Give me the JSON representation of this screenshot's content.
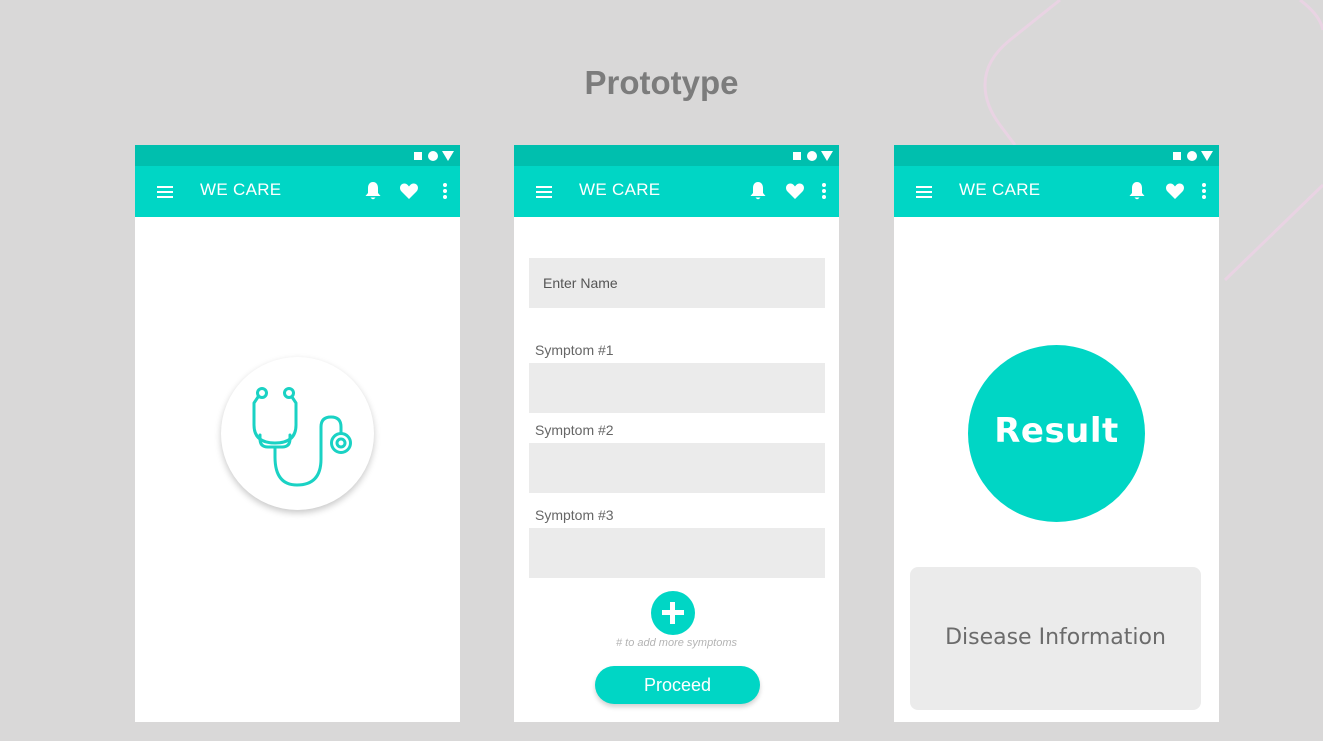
{
  "page": {
    "title": "Prototype"
  },
  "colors": {
    "background": "#d9d8d8",
    "status_bar": "#00bfae",
    "app_bar": "#00d6c5",
    "accent": "#00d6c5",
    "field_bg": "#ebebeb"
  },
  "status_bar": {
    "icons": [
      "square-icon",
      "circle-icon",
      "triangle-icon"
    ]
  },
  "app_bar": {
    "title": "WE CARE",
    "icons": [
      "menu-icon",
      "bell-icon",
      "heart-icon",
      "more-vert-icon"
    ]
  },
  "screens": {
    "splash": {
      "logo_icon": "stethoscope-icon"
    },
    "form": {
      "name_placeholder": "Enter Name",
      "symptom_labels": [
        "Symptom #1",
        "Symptom #2",
        "Symptom #3"
      ],
      "add_icon": "plus-icon",
      "hint": "# to add more symptoms",
      "proceed_label": "Proceed"
    },
    "result": {
      "result_label": "Result",
      "info_label": "Disease Information"
    }
  }
}
